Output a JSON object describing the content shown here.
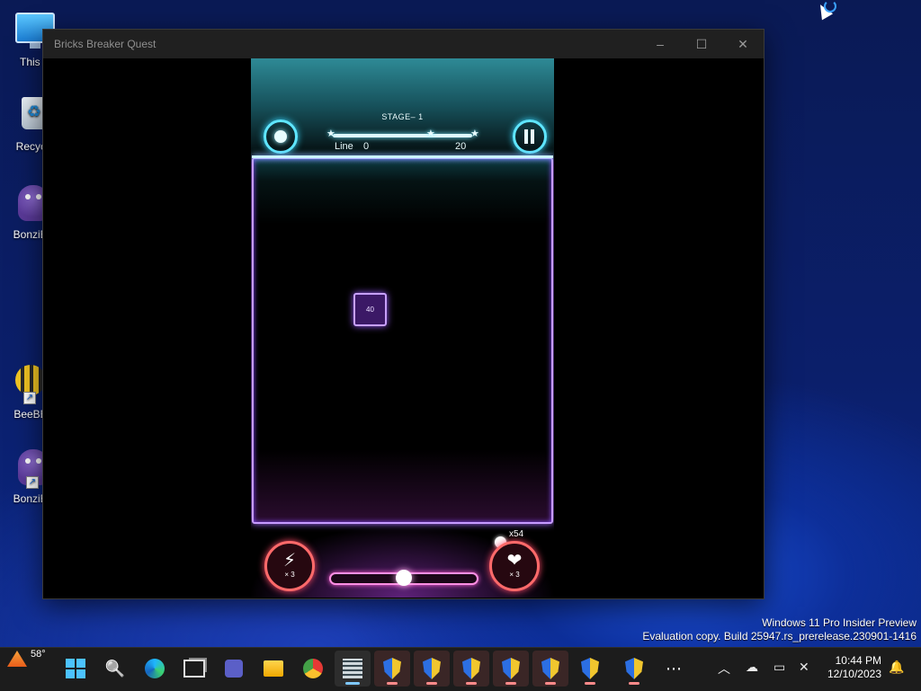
{
  "desktop": {
    "icons": [
      {
        "label": "This P",
        "icon": "computer-icon"
      },
      {
        "label": "Recycle",
        "icon": "recycle-bin-icon"
      },
      {
        "label": "BonziBu",
        "icon": "bonzi-icon"
      },
      {
        "label": "BeeBE",
        "icon": "bee-icon"
      },
      {
        "label": "BonziBu",
        "icon": "bonzi-icon"
      }
    ]
  },
  "window": {
    "title": "Bricks Breaker Quest",
    "controls": {
      "minimize": "–",
      "maximize": "☐",
      "close": "✕"
    }
  },
  "game": {
    "stage_label": "STAGE– 1",
    "line_label": "Line",
    "line_current": "0",
    "line_target": "20",
    "stars": [
      "★",
      "★",
      "★"
    ],
    "brick": {
      "value": "40"
    },
    "ball_count": "x54",
    "powerups": {
      "lightning": {
        "symbol": "⚡",
        "count": "× 3",
        "icon": "lightning-icon"
      },
      "multiball": {
        "symbol": "❤",
        "count": "× 3",
        "icon": "multiball-icon"
      }
    },
    "slider_value": 0.5,
    "colors": {
      "cyan_glow": "#5fe6ff",
      "purple_glow": "#c79bff",
      "pink_glow": "#ff8fe4",
      "red_glow": "#ff6a6a"
    }
  },
  "watermark": {
    "line1": "Windows 11 Pro Insider Preview",
    "line2": "Evaluation copy. Build 25947.rs_prerelease.230901-1416"
  },
  "taskbar": {
    "weather": {
      "temp": "58°"
    },
    "search_glyph": "🔍",
    "chrome_glyph": "◉",
    "more_glyph": "⋯",
    "tray": {
      "chevron": "︿",
      "time": "10:44 PM",
      "date": "12/10/2023"
    }
  }
}
